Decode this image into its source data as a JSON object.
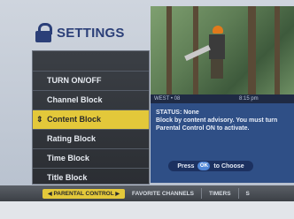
{
  "header": {
    "title": "SETTINGS"
  },
  "menu": {
    "items": [
      {
        "label": "TURN ON/OFF"
      },
      {
        "label": "Channel Block"
      },
      {
        "label": "Content Block",
        "selected": true
      },
      {
        "label": "Rating Block"
      },
      {
        "label": "Time Block"
      },
      {
        "label": "Title Block"
      }
    ]
  },
  "preview": {
    "channel": "WEST • 08",
    "time": "8:15 pm"
  },
  "info": {
    "status": "STATUS: None",
    "description": "Block by content advisory. You must turn Parental Control ON to activate.",
    "press_label": "Press",
    "ok_label": "OK",
    "choose_label": "to Choose"
  },
  "tabs": [
    {
      "label": "PARENTAL CONTROL",
      "active": true
    },
    {
      "label": "FAVORITE CHANNELS"
    },
    {
      "label": "TIMERS"
    },
    {
      "label": "S"
    }
  ],
  "colors": {
    "accent": "#e3c83a",
    "brand_blue": "#2b3f78",
    "panel": "#2f4f86"
  }
}
